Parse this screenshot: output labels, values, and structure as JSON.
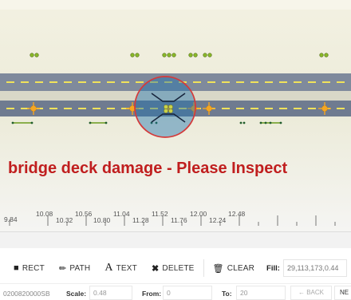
{
  "canvas": {
    "annotation_text": "bridge deck damage - Please Inspect",
    "ticks": [
      "9.84",
      "10.08",
      "10.32",
      "10.56",
      "10.80",
      "11.04",
      "11.28",
      "11.52",
      "11.76",
      "12.00",
      "12.24",
      "12.48"
    ]
  },
  "toolbar": {
    "rect_label": "RECT",
    "path_label": "PATH",
    "text_label": "TEXT",
    "text_icon": "A",
    "delete_label": "DELETE",
    "clear_label": "CLEAR",
    "fill_label": "Fill:",
    "fill_value": "29,113,173,0.44"
  },
  "bottom": {
    "id_text": "0200820000SB",
    "scale_label": "Scale:",
    "scale_value": "0.48",
    "from_label": "From:",
    "from_value": "0",
    "to_label": "To:",
    "to_value": "20",
    "back_label": "← BACK",
    "next_label": "NE"
  },
  "colors": {
    "background": "#ecebd8",
    "lane": "#7f8a9c",
    "dash": "#f0e25a",
    "marker_orange": "#f5a623",
    "marker_green": "#8ab82a",
    "circle_fill": "rgba(29,113,173,0.44)",
    "circle_stroke": "#d43a3a",
    "annotation": "#c01e1e"
  }
}
